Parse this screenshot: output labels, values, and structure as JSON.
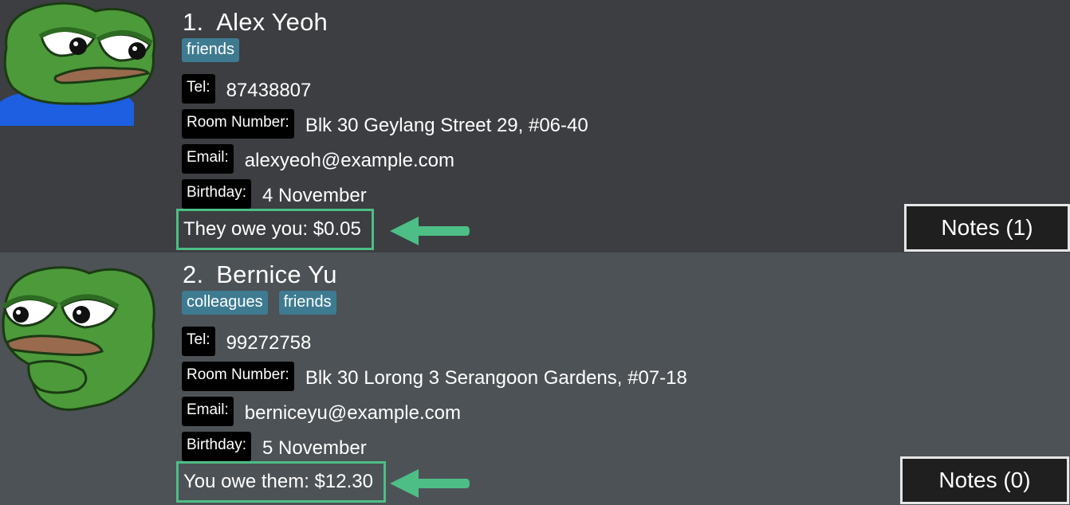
{
  "persons": [
    {
      "index": "1.",
      "name": "Alex Yeoh",
      "tags": [
        "friends"
      ],
      "tel_label": "Tel:",
      "tel": "87438807",
      "room_label": "Room Number:",
      "room": "Blk 30 Geylang Street 29, #06-40",
      "email_label": "Email:",
      "email": "alexyeoh@example.com",
      "birthday_label": "Birthday:",
      "birthday": "4 November",
      "owe_text": "They owe you: $0.05",
      "notes_label": "Notes (1)"
    },
    {
      "index": "2.",
      "name": "Bernice Yu",
      "tags": [
        "colleagues",
        "friends"
      ],
      "tel_label": "Tel:",
      "tel": "99272758",
      "room_label": "Room Number:",
      "room": "Blk 30 Lorong 3 Serangoon Gardens, #07-18",
      "email_label": "Email:",
      "email": "berniceyu@example.com",
      "birthday_label": "Birthday:",
      "birthday": "5 November",
      "owe_text": "You owe them: $12.30",
      "notes_label": "Notes (0)"
    }
  ],
  "colors": {
    "card_bg_odd": "#3c3e42",
    "card_bg_even": "#4d5256",
    "tag_bg": "#3e7b91",
    "label_bg": "#000000",
    "highlight": "#4dbe85",
    "notes_bg": "#1f1f1f",
    "notes_border": "#e6e6e6"
  },
  "icons": {
    "avatar_1": "pepe-frog-avatar-icon",
    "avatar_2": "pepe-frog-thinking-avatar-icon",
    "arrow": "left-arrow-icon"
  }
}
